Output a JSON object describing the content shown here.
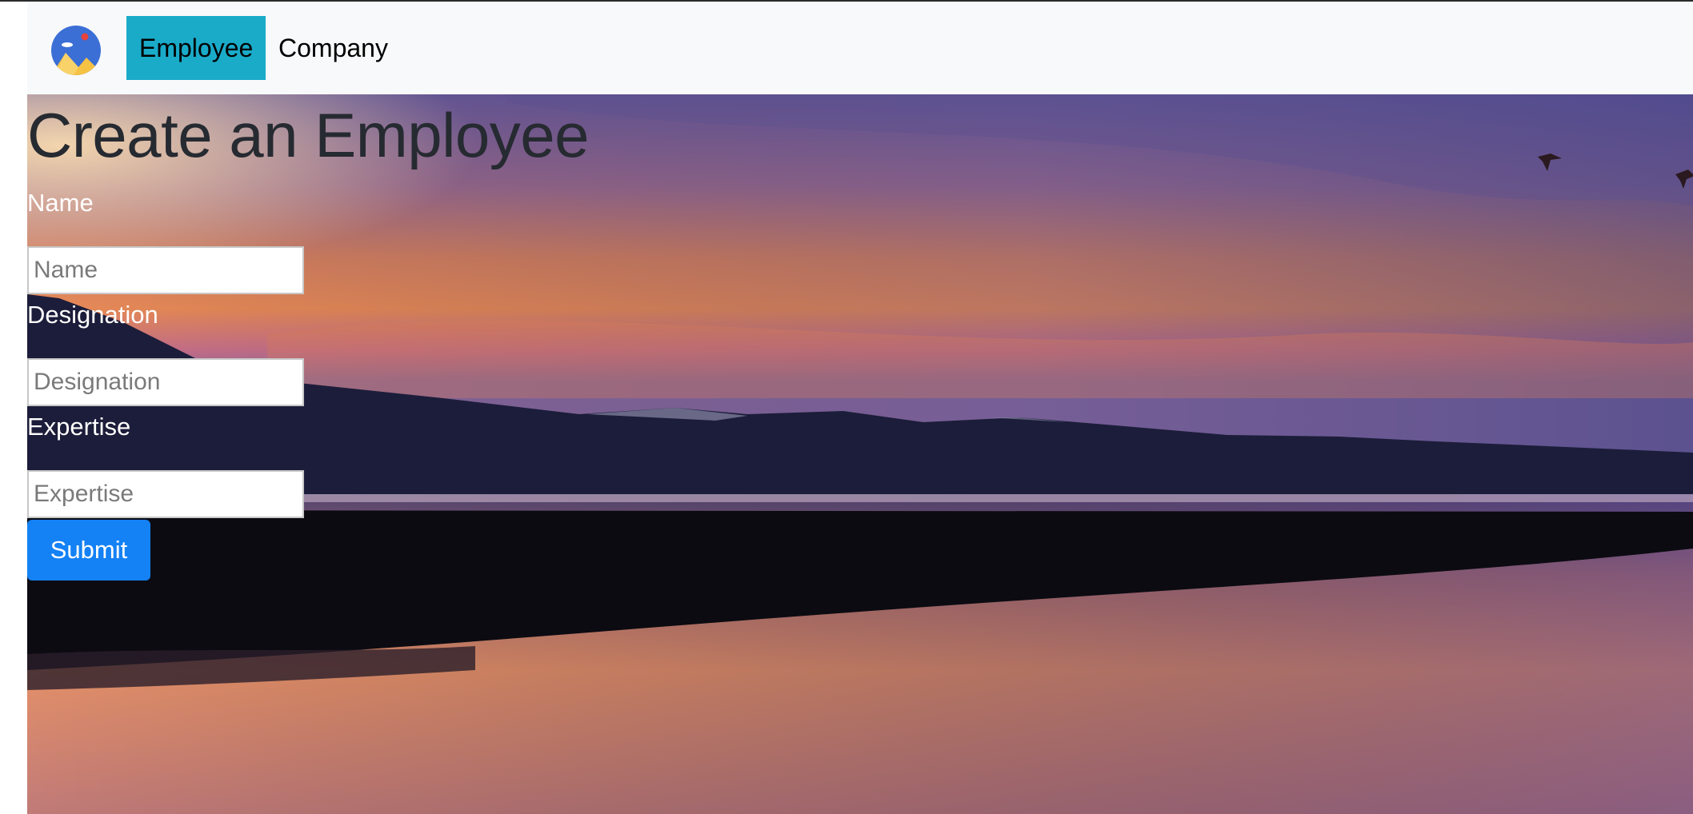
{
  "nav": {
    "logo_icon": "mountain-sun-logo-icon",
    "items": [
      {
        "label": "Employee",
        "active": true
      },
      {
        "label": "Company",
        "active": false
      }
    ],
    "active_color": "#1aabc9"
  },
  "main": {
    "title": "Create an Employee",
    "background": "sunset-lake-mountains-image",
    "fields": [
      {
        "label": "Name",
        "placeholder": "Name",
        "value": ""
      },
      {
        "label": "Designation",
        "placeholder": "Designation",
        "value": ""
      },
      {
        "label": "Expertise",
        "placeholder": "Expertise",
        "value": ""
      }
    ],
    "submit_label": "Submit",
    "submit_color": "#1481f5"
  }
}
